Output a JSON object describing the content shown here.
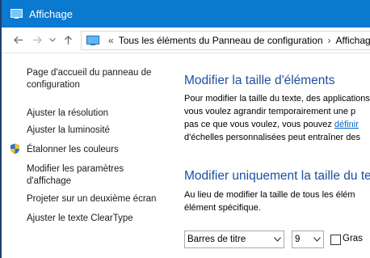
{
  "window": {
    "title": "Affichage"
  },
  "addressbar": {
    "back_icon": "arrow-left-icon",
    "forward_icon": "arrow-right-icon",
    "recent_icon": "chevron-down-icon",
    "up_icon": "arrow-up-icon",
    "separator": "«",
    "crumbs": [
      "Tous les éléments du Panneau de configuration",
      "Affichage"
    ],
    "crumb_sep": "›"
  },
  "sidebar": {
    "items": [
      {
        "label_line1": "Page d'accueil du panneau de",
        "label_line2": "configuration"
      },
      {
        "label": "Ajuster la résolution"
      },
      {
        "label": "Ajuster la luminosité"
      },
      {
        "label": "Étalonner les couleurs",
        "icon": "shield-icon"
      },
      {
        "label_line1": "Modifier les paramètres",
        "label_line2": "d'affichage"
      },
      {
        "label": "Projeter sur un deuxième écran"
      },
      {
        "label": "Ajuster le texte ClearType"
      }
    ]
  },
  "main": {
    "section1": {
      "title": "Modifier la taille d'éléments",
      "line1": "Pour modifier la taille du texte, des applications",
      "line2": "vous voulez agrandir temporairement une p",
      "line3_pre": "pas ce que vous voulez, vous pouvez ",
      "line3_link": "définir",
      "line4": "d'échelles personnalisées peut entraîner des"
    },
    "section2": {
      "title": "Modifier uniquement la taille du te",
      "line1": "Au lieu de modifier la taille de tous les élém",
      "line2": "élément spécifique."
    },
    "controls": {
      "element_select": "Barres de titre",
      "size_select": "9",
      "bold_label": "Gras",
      "bold_checked": false
    }
  },
  "colors": {
    "titlebar": "#0a7ad0",
    "heading": "#1e4fa0",
    "link": "#0066cc"
  }
}
